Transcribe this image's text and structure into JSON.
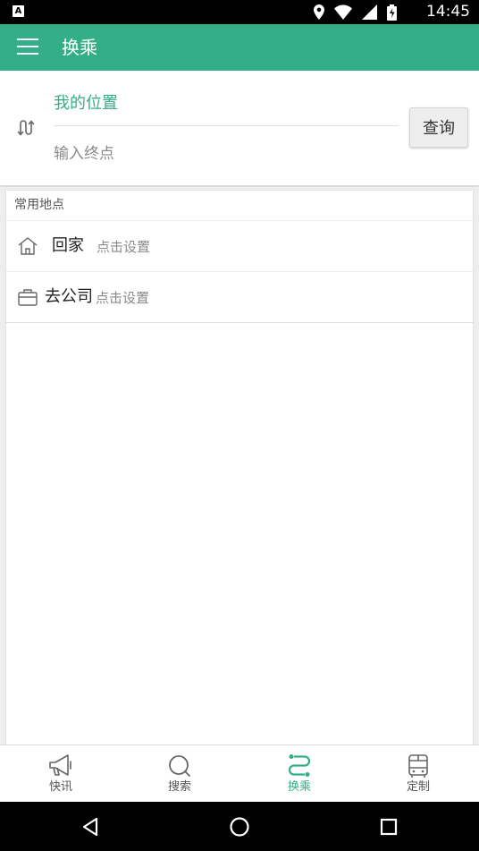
{
  "status_bar": {
    "app_badge": "A",
    "time": "14:45",
    "icons": [
      "location-icon",
      "wifi-icon",
      "signal-icon",
      "battery-icon"
    ]
  },
  "app_bar": {
    "title": "换乘",
    "menu_icon": "hamburger-menu-icon",
    "color": "#34ae86"
  },
  "route": {
    "origin": "我的位置",
    "destination_placeholder": "输入终点",
    "query_label": "查询",
    "swap_icon": "swap-route-icon"
  },
  "common_places": {
    "header": "常用地点",
    "items": [
      {
        "icon": "home-icon",
        "name": "回家",
        "hint": "点击设置"
      },
      {
        "icon": "briefcase-icon",
        "name": "去公司",
        "hint": "点击设置"
      }
    ]
  },
  "bottom_nav": {
    "items": [
      {
        "icon": "megaphone-icon",
        "label": "快讯",
        "active": false
      },
      {
        "icon": "search-icon",
        "label": "搜索",
        "active": false
      },
      {
        "icon": "transfer-icon",
        "label": "换乘",
        "active": true
      },
      {
        "icon": "bus-icon",
        "label": "定制",
        "active": false
      }
    ],
    "active_color": "#34ae86"
  },
  "system_nav": [
    "back-icon",
    "home-circle-icon",
    "recents-icon"
  ]
}
